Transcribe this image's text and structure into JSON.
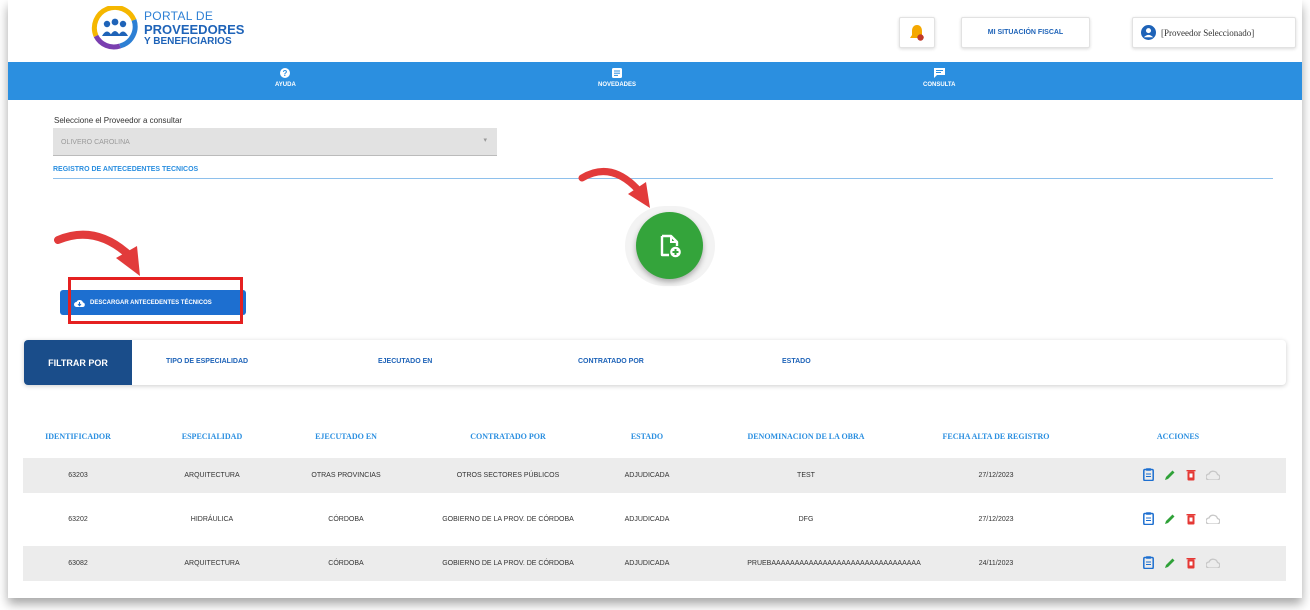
{
  "header": {
    "brand_line1": "PORTAL DE",
    "brand_line2": "PROVEEDORES",
    "brand_line3": "Y BENEFICIARIOS",
    "fiscal_label": "MI SITUACIÓN FISCAL",
    "provider_label": "[Proveedor Seleccionado]"
  },
  "nav": {
    "items": [
      {
        "label": "AYUDA",
        "icon": "help-circle-icon"
      },
      {
        "label": "NOVEDADES",
        "icon": "news-icon"
      },
      {
        "label": "CONSULTA",
        "icon": "chat-icon"
      }
    ]
  },
  "form": {
    "select_label": "Seleccione el Proveedor a consultar",
    "select_value": "OLIVERO CAROLINA",
    "section_title": "REGISTRO DE ANTECEDENTES TECNICOS"
  },
  "download_button": "DESCARGAR ANTECEDENTES TÉCNICOS",
  "filter": {
    "label": "FILTRAR POR",
    "options": [
      "TIPO DE ESPECIALIDAD",
      "EJECUTADO EN",
      "CONTRATADO POR",
      "ESTADO"
    ]
  },
  "table": {
    "headers": [
      "IDENTIFICADOR",
      "ESPECIALIDAD",
      "EJECUTADO EN",
      "CONTRATADO POR",
      "ESTADO",
      "DENOMINACION DE LA OBRA",
      "FECHA ALTA DE REGISTRO",
      "ACCIONES"
    ],
    "rows": [
      [
        "63203",
        "ARQUITECTURA",
        "OTRAS PROVINCIAS",
        "OTROS SECTORES PÚBLICOS",
        "ADJUDICADA",
        "TEST",
        "27/12/2023"
      ],
      [
        "63202",
        "HIDRÁULICA",
        "CÓRDOBA",
        "GOBIERNO DE LA PROV. DE CÓRDOBA",
        "ADJUDICADA",
        "DFG",
        "27/12/2023"
      ],
      [
        "63082",
        "ARQUITECTURA",
        "CÓRDOBA",
        "GOBIERNO DE LA PROV. DE CÓRDOBA",
        "ADJUDICADA",
        "PRUEBAAAAAAAAAAAAAAAAAAAAAAAAAAAAAAAA",
        "24/11/2023"
      ]
    ]
  },
  "colors": {
    "nav_blue": "#2b8fe0",
    "filter_dark": "#1a4d8a",
    "fab_green": "#34a43b",
    "annotation_red": "#e52020"
  }
}
